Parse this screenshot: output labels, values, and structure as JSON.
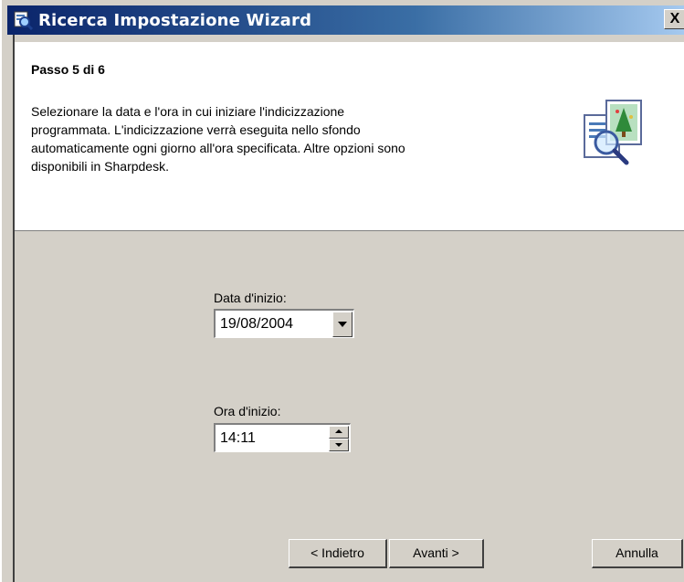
{
  "window": {
    "title": "Ricerca Impostazione Wizard",
    "close_symbol": "X"
  },
  "header": {
    "step": "Passo 5 di 6",
    "description": "Selezionare la data e l'ora in cui iniziare l'indicizzazione\nprogrammata. L'indicizzazione verrà eseguita nello sfondo\nautomaticamente ogni giorno all'ora specificata. Altre opzioni sono\ndisponibili in Sharpdesk.",
    "icon": "search-document-icon"
  },
  "start_date": {
    "label": "Data d'inizio:",
    "value": "19/08/2004",
    "icon": "chevron-down-icon"
  },
  "start_time": {
    "label": "Ora d'inizio:",
    "value": "14:11"
  },
  "buttons": {
    "back": "< Indietro",
    "next": "Avanti >",
    "cancel": "Annulla"
  },
  "colors": {
    "titlebar": "#0a246a",
    "dialog_bg": "#d4d0c8"
  }
}
